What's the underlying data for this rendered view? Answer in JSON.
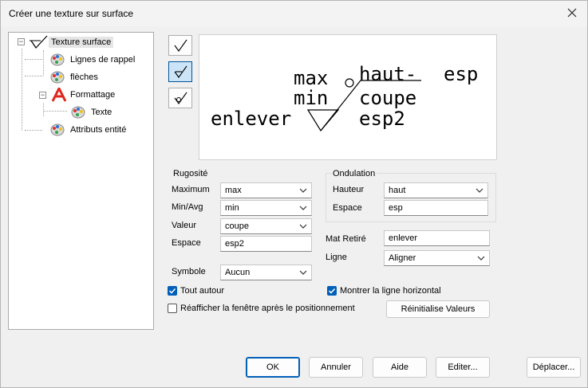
{
  "window": {
    "title": "Créer une texture sur surface"
  },
  "tree": {
    "items": [
      {
        "label": "Texture surface"
      },
      {
        "label": "Lignes de rappel"
      },
      {
        "label": "flèches"
      },
      {
        "label": "Formattage"
      },
      {
        "label": "Texte"
      },
      {
        "label": "Attributs entité"
      }
    ]
  },
  "preview": {
    "max": "max",
    "min": "min",
    "haut": "haut-",
    "esp": "esp",
    "coupe": "coupe",
    "enlever": "enlever",
    "esp2": "esp2"
  },
  "rugosite": {
    "title": "Rugosité",
    "maximum_label": "Maximum",
    "maximum_value": "max",
    "minavg_label": "Min/Avg",
    "minavg_value": "min",
    "valeur_label": "Valeur",
    "valeur_value": "coupe",
    "espace_label": "Espace",
    "espace_value": "esp2"
  },
  "ondulation": {
    "title": "Ondulation",
    "hauteur_label": "Hauteur",
    "hauteur_value": "haut",
    "espace_label": "Espace",
    "espace_value": "esp"
  },
  "mat_retire": {
    "label": "Mat Retiré",
    "value": "enlever"
  },
  "ligne": {
    "label": "Ligne",
    "value": "Aligner"
  },
  "symbole": {
    "label": "Symbole",
    "value": "Aucun"
  },
  "checks": {
    "tout_autour": "Tout autour",
    "montrer_ligne": "Montrer la ligne horizontal",
    "reafficher": "Réafficher la fenêtre après le positionnement"
  },
  "buttons": {
    "reinit": "Réinitialise Valeurs",
    "ok": "OK",
    "annuler": "Annuler",
    "aide": "Aide",
    "editer": "Editer...",
    "deplacer": "Déplacer..."
  }
}
